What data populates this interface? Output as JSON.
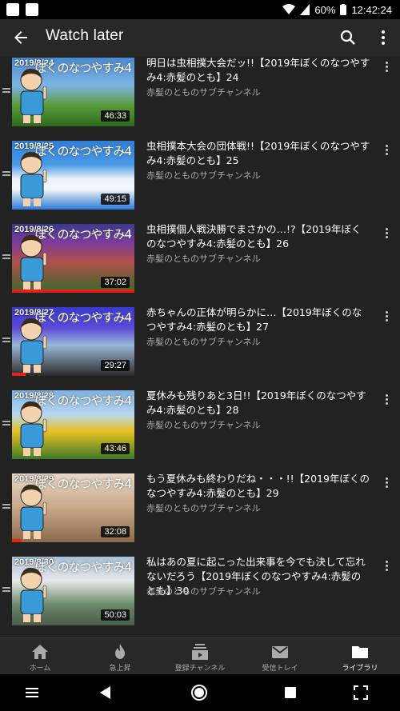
{
  "status_bar": {
    "battery": "60%",
    "time": "12:42:24"
  },
  "header": {
    "title": "Watch later"
  },
  "videos": [
    {
      "date": "2019/8/24",
      "logo": "ぼくのなつやすみ4",
      "duration": "46:33",
      "progress": 0.0,
      "title": "明日は虫相撲大会だッ!!【2019年ぼくのなつやすみ4:赤髪のとも】24",
      "channel": "赤髪のとものサブチャンネル"
    },
    {
      "date": "2019/8/25",
      "logo": "ぼくのなつやすみ4",
      "duration": "49:15",
      "progress": 0.0,
      "title": "虫相撲本大会の団体戦!!【2019年ぼくのなつやすみ4:赤髪のとも】25",
      "channel": "赤髪のとものサブチャンネル"
    },
    {
      "date": "2019/8/26",
      "logo": "ぼくのなつやすみ4",
      "duration": "37:02",
      "progress": 1.0,
      "title": "虫相撲個人戦決勝でまさかの…!?【2019年ぼくのなつやすみ4:赤髪のとも】26",
      "channel": "赤髪のとものサブチャンネル"
    },
    {
      "date": "2019/8/27",
      "logo": "ぼくのなつやすみ4",
      "duration": "29:27",
      "progress": 0.11,
      "title": "赤ちゃんの正体が明らかに…【2019年ぼくのなつやすみ4:赤髪のとも】27",
      "channel": "赤髪のとものサブチャンネル"
    },
    {
      "date": "2019/8/28",
      "logo": "ぼくのなつやすみ4",
      "duration": "43:46",
      "progress": 0.0,
      "title": "夏休みも残りあと3日!!【2019年ぼくのなつやすみ4:赤髪のとも】28",
      "channel": "赤髪のとものサブチャンネル"
    },
    {
      "date": "2019/8/29",
      "logo": "ぼくのなつやすみ4",
      "duration": "32:08",
      "progress": 0.08,
      "title": "もう夏休みも終わりだね・・・!!【2019年ぼくのなつやすみ4:赤髪のとも】29",
      "channel": "赤髪のとものサブチャンネル"
    },
    {
      "date": "2019/8/30",
      "logo": "ぼくのなつやすみ4",
      "duration": "50:03",
      "progress": 0.0,
      "title": "私はあの夏に起こった出来事を今でも決して忘れないだろう【2019年ぼくのなつやすみ4:赤髪のとも】30",
      "channel": "赤髪のとものサブチャンネル"
    }
  ],
  "bottom_nav": [
    {
      "label": "ホーム",
      "icon": "home-icon"
    },
    {
      "label": "急上昇",
      "icon": "trending-icon"
    },
    {
      "label": "登録チャンネル",
      "icon": "subscriptions-icon"
    },
    {
      "label": "受信トレイ",
      "icon": "inbox-icon"
    },
    {
      "label": "ライブラリ",
      "icon": "library-icon",
      "active": true
    }
  ],
  "colors": {
    "accent": "#e62117",
    "background": "#222222",
    "app_bar": "#282828"
  }
}
